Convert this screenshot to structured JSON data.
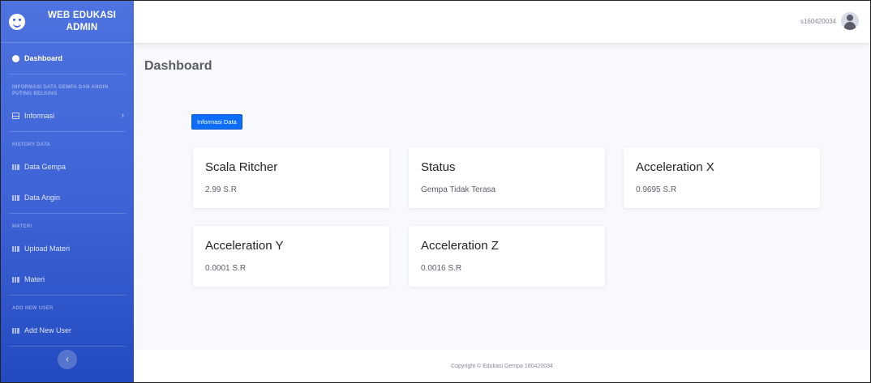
{
  "brand": {
    "line1": "WEB EDUKASI",
    "line2": "ADMIN",
    "icon": "laugh-icon"
  },
  "sidebar": {
    "dashboard": "Dashboard",
    "heading_info": "INFORMASI DATA GEMPA DAN ANGIN PUTING BELIUNG",
    "informasi": "Informasi",
    "heading_history": "HISTORY DATA",
    "data_gempa": "Data Gempa",
    "data_angin": "Data Angin",
    "heading_materi": "MATERI",
    "upload_materi": "Upload Materi",
    "materi": "Materi",
    "heading_user": "ADD NEW USER",
    "add_new_user": "Add New User",
    "toggle": "‹"
  },
  "topbar": {
    "username": "s160420034"
  },
  "main": {
    "page_title": "Dashboard",
    "info_button": "Informasi Data",
    "cards": [
      {
        "title": "Scala Ritcher",
        "value": "2.99 S.R"
      },
      {
        "title": "Status",
        "value": "Gempa Tidak Terasa"
      },
      {
        "title": "Acceleration X",
        "value": "0.9695 S.R"
      },
      {
        "title": "Acceleration Y",
        "value": "0.0001 S.R"
      },
      {
        "title": "Acceleration Z",
        "value": "0.0016 S.R"
      }
    ]
  },
  "footer": {
    "copyright": "Copyright © Edukasi Gempa 160420034"
  },
  "colors": {
    "sidebar": "#4e73df",
    "button": "#0d6efd",
    "background": "#f8f9fc"
  }
}
